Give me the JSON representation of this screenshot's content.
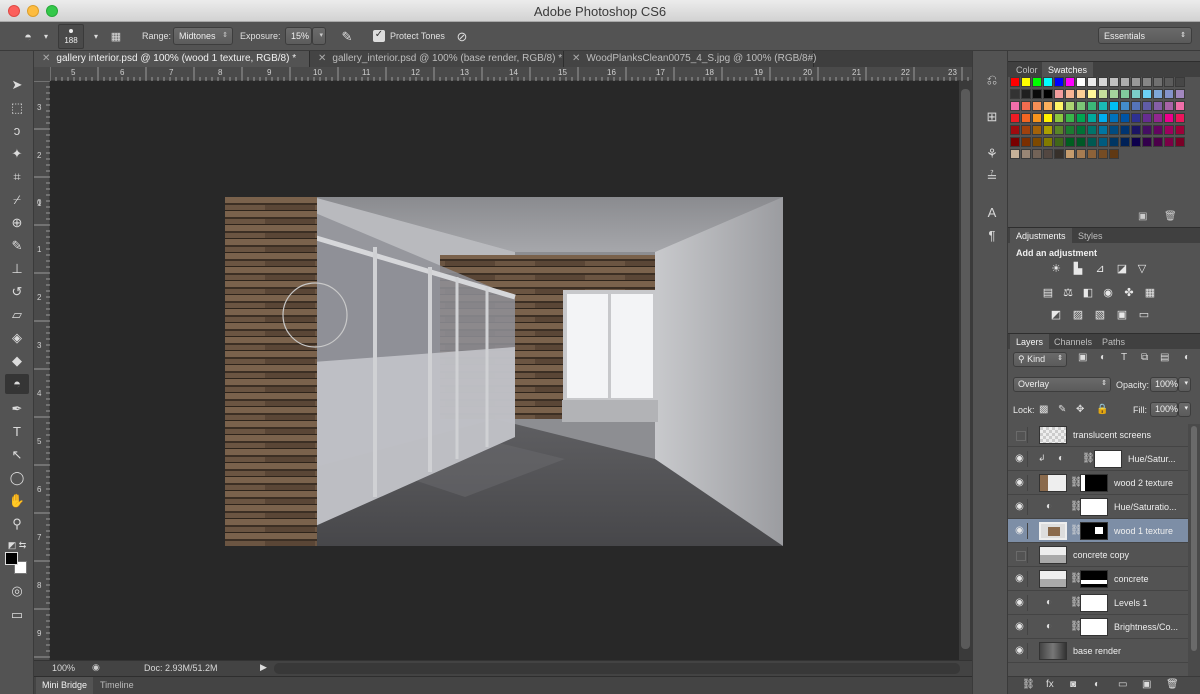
{
  "app": {
    "title": "Adobe Photoshop CS6"
  },
  "options_bar": {
    "brush_size": "188",
    "range_label": "Range:",
    "range_value": "Midtones",
    "exposure_label": "Exposure:",
    "exposure_value": "15%",
    "protect_tones_label": "Protect Tones",
    "protect_tones_checked": true,
    "workspace": "Essentials"
  },
  "document_tabs": [
    {
      "label": "gallery interior.psd @ 100% (wood 1 texture, RGB/8) *",
      "active": true
    },
    {
      "label": "gallery_interior.psd @ 100% (base render, RGB/8) *",
      "active": false
    },
    {
      "label": "WoodPlanksClean0075_4_S.jpg @ 100% (RGB/8#)",
      "active": false
    }
  ],
  "ruler": {
    "top_ticks": [
      "5",
      "6",
      "7",
      "8",
      "9",
      "10",
      "11",
      "12",
      "13",
      "14",
      "15",
      "16",
      "17",
      "18",
      "19",
      "20",
      "21",
      "22",
      "23"
    ],
    "left_ticks": [
      "3",
      "2",
      "1",
      "0",
      "1",
      "2",
      "3",
      "4",
      "5",
      "6",
      "7",
      "8",
      "9"
    ]
  },
  "status": {
    "zoom": "100%",
    "doc_info": "Doc: 2.93M/51.2M"
  },
  "bottom_tabs": [
    "Mini Bridge",
    "Timeline"
  ],
  "color_panel": {
    "tabs": [
      "Color",
      "Swatches"
    ],
    "active_tab": "Swatches"
  },
  "adjustments_panel": {
    "tabs": [
      "Adjustments",
      "Styles"
    ],
    "title": "Add an adjustment",
    "row1_icons": [
      "brightness-contrast-icon",
      "levels-icon",
      "curves-icon",
      "exposure-icon",
      "vibrance-icon"
    ],
    "row2_icons": [
      "hue-saturation-icon",
      "color-balance-icon",
      "black-white-icon",
      "photo-filter-icon",
      "channel-mixer-icon",
      "color-lookup-icon"
    ],
    "row3_icons": [
      "invert-icon",
      "posterize-icon",
      "threshold-icon",
      "selective-color-icon",
      "gradient-map-icon"
    ]
  },
  "layers_panel": {
    "tabs": [
      "Layers",
      "Channels",
      "Paths"
    ],
    "filter_label": "Kind",
    "blend_mode": "Overlay",
    "opacity_label": "Opacity:",
    "opacity_value": "100%",
    "lock_label": "Lock:",
    "fill_label": "Fill:",
    "fill_value": "100%",
    "layers": [
      {
        "name": "translucent screens",
        "visible": false,
        "kind": "pixel",
        "selected": false
      },
      {
        "name": "Hue/Satur...",
        "visible": true,
        "kind": "adjustment",
        "clipped": true,
        "selected": false
      },
      {
        "name": "wood 2 texture",
        "visible": true,
        "kind": "pixel-mask",
        "selected": false
      },
      {
        "name": "Hue/Saturatio...",
        "visible": true,
        "kind": "adjustment",
        "selected": false
      },
      {
        "name": "wood 1 texture",
        "visible": true,
        "kind": "pixel-mask",
        "selected": true
      },
      {
        "name": "concrete copy",
        "visible": false,
        "kind": "pixel",
        "selected": false
      },
      {
        "name": "concrete",
        "visible": true,
        "kind": "pixel-mask",
        "selected": false
      },
      {
        "name": "Levels 1",
        "visible": true,
        "kind": "adjustment",
        "selected": false
      },
      {
        "name": "Brightness/Co...",
        "visible": true,
        "kind": "adjustment",
        "selected": false
      },
      {
        "name": "base render",
        "visible": true,
        "kind": "pixel",
        "selected": false
      }
    ]
  },
  "colors": {
    "ui_dark": "#535353",
    "canvas_bg": "#282828",
    "selection": "#7d8ea6",
    "foreground": "#000000",
    "background": "#ffffff"
  }
}
